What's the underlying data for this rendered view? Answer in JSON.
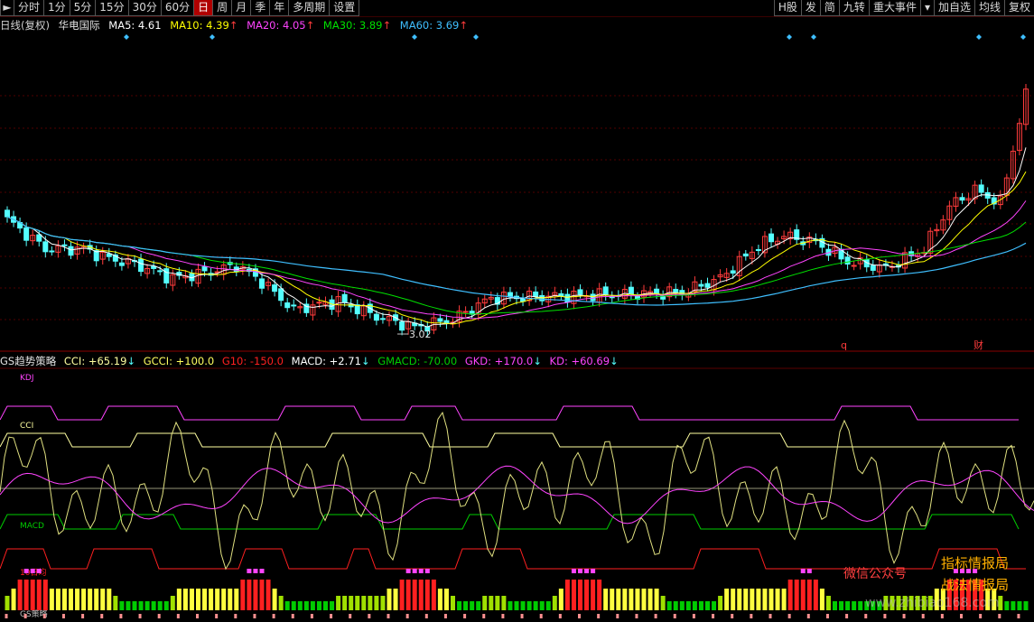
{
  "toolbar": {
    "left": [
      "分时",
      "1分",
      "5分",
      "15分",
      "30分",
      "60分",
      "日",
      "周",
      "月",
      "季",
      "年",
      "多周期",
      "设置"
    ],
    "active": "日",
    "right": [
      "H股",
      "发",
      "简",
      "九转",
      "重大事件",
      "加自选",
      "均线",
      "复权"
    ]
  },
  "legend": {
    "period": "日线(复权)",
    "name": "华电国际",
    "ma5": "MA5: 4.61",
    "ma10": "MA10: 4.39",
    "ma20": "MA20: 4.05",
    "ma30": "MA30: 3.89",
    "ma60": "MA60: 3.69"
  },
  "sub_legend": {
    "name": "GS趋势策略",
    "cci": "CCI: +65.19",
    "gcci": "GCCI: +100.0",
    "g10": "G10: -150.0",
    "macd": "MACD: +2.71",
    "gmacd": "GMACD: -70.00",
    "gkd": "GKD: +170.0",
    "kd": "KD: +60.69"
  },
  "annotations": {
    "low_price": "3.02",
    "q_mark": "q",
    "cai_mark": "财"
  },
  "sub_labels": {
    "kdj": "KDJ",
    "cci": "CCI",
    "macd": "MACD",
    "ma10": "10日均",
    "gs": "GS策略"
  },
  "watermark": {
    "line1": "指标情报局",
    "line2": "战法情报局",
    "wechat": "微信公众号",
    "url": "www.zhibiao168.com"
  },
  "colors": {
    "up": "#ff3c3c",
    "down": "#54ffff",
    "ma5": "#ffffff",
    "ma10": "#ffff00",
    "ma20": "#ff44ff",
    "ma30": "#00e000",
    "ma60": "#3fbfff",
    "kdj": "#ff44ff",
    "cci_ref": "#ffffa0",
    "macd": "#00cc00",
    "g10": "#ff2020"
  }
}
